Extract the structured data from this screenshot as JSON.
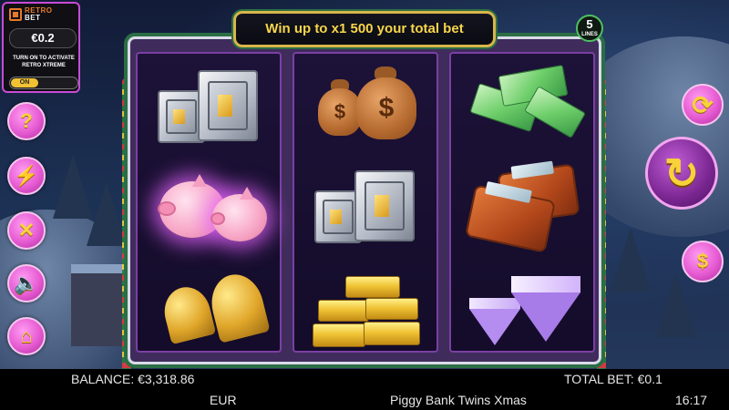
{
  "game": {
    "title": "Piggy Bank Twins Xmas",
    "banner_text": "Win up to x1 500 your total bet",
    "lines_count": "5",
    "lines_label": "LINES"
  },
  "logo": {
    "brand_part1": "RETRO",
    "brand_part2": "BET"
  },
  "bet_panel": {
    "bet_value": "€0.2",
    "xtreme_text": "TURN ON TO ACTIVATE RETRO XTREME",
    "toggle_label": "ON"
  },
  "side_buttons": {
    "help_icon": "?",
    "turbo_icon": "⚡",
    "settings_icon": "✕",
    "sound_icon": "🔈",
    "home_icon": "⌂"
  },
  "right_buttons": {
    "autoplay_icon": "⟳",
    "spin_icon": "↻",
    "currency_icon": "$"
  },
  "reels": [
    [
      "safe",
      "piggy-bank",
      "bells"
    ],
    [
      "money-bags",
      "safe",
      "gold-bars"
    ],
    [
      "cash-stack",
      "wallet",
      "diamonds"
    ]
  ],
  "symbol_text": {
    "bag_sign": "$"
  },
  "footer": {
    "balance_label": "BALANCE: €3,318.86",
    "currency": "EUR",
    "total_bet_label": "TOTAL BET: €0.1",
    "game_name": "Piggy Bank Twins Xmas",
    "clock": "16:17"
  },
  "colors": {
    "accent_pink": "#e65bd2",
    "accent_gold": "#f7d64a",
    "banner_border": "#d7b64a",
    "reel_frame": "#7b3fa3"
  }
}
